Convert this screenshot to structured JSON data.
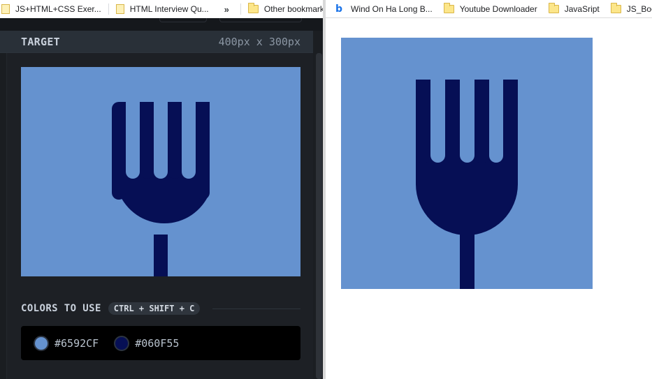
{
  "bookmarks_left": [
    {
      "label": "JS+HTML+CSS Exer...",
      "icon": "page-icon"
    },
    {
      "label": "HTML Interview Qu...",
      "icon": "page-icon"
    },
    {
      "label": "Other bookmarks",
      "icon": "folder-icon"
    }
  ],
  "bookmarks_overflow": "»",
  "bookmarks_right": [
    {
      "label": "Wind On Ha Long B...",
      "icon": "bing-icon"
    },
    {
      "label": "Youtube Downloader",
      "icon": "folder-icon"
    },
    {
      "label": "JavaSript",
      "icon": "folder-icon"
    },
    {
      "label": "JS_Book",
      "icon": "folder-icon"
    }
  ],
  "target": {
    "title": "TARGET",
    "dimensions": "400px x 300px"
  },
  "colors_section": {
    "title": "COLORS TO USE",
    "shortcut": "CTRL + SHIFT + C",
    "swatches": [
      {
        "hex": "#6592CF"
      },
      {
        "hex": "#060F55"
      }
    ]
  },
  "colors": {
    "background": "#6592CF",
    "fork": "#060F55",
    "panel": "#1d2025"
  }
}
